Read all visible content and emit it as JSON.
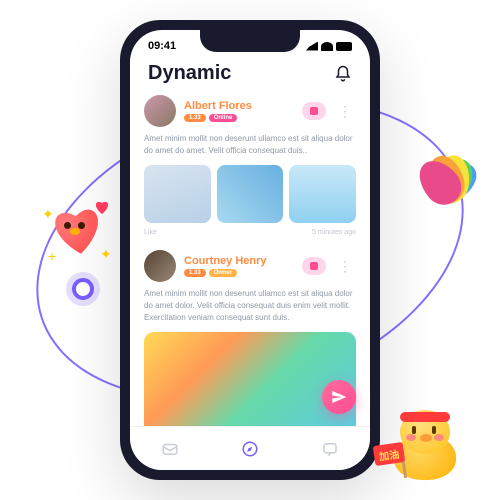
{
  "status": {
    "time": "09:41"
  },
  "header": {
    "title": "Dynamic"
  },
  "posts": [
    {
      "name": "Albert Flores",
      "level": "1.33",
      "badge": "Online",
      "text": "Amet minim mollit non deserunt ullamco est sit aliqua dolor do amet do amet. Velit officia consequat duis..",
      "likes": "Like",
      "time": "5 minutes ago"
    },
    {
      "name": "Courtney Henry",
      "level": "1.33",
      "badge": "Owner",
      "text": "Amet minim mollit non deserunt ullamco est sit aliqua dolor do amet dolor. Velit officia consequat duis enim velit mollit. Exercitation veniam consequat sunt duis."
    }
  ],
  "mascot": {
    "flag": "加油"
  }
}
